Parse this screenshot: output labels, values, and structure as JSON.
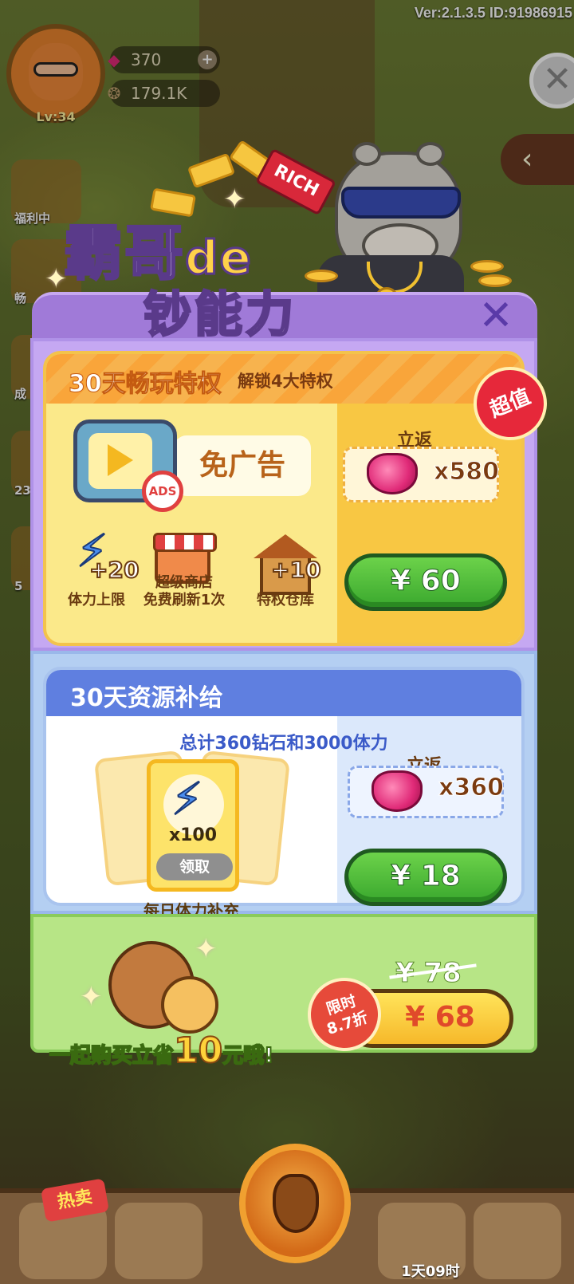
{
  "hud": {
    "version": "Ver:2.1.3.5 ID:91986915",
    "level": "Lv:34",
    "gems": "370",
    "acorns": "179.1K",
    "left_menu_labels": [
      "福利中",
      "畅",
      "成",
      "23",
      "5"
    ]
  },
  "banner": {
    "title_line1": "霸哥",
    "title_de": "de",
    "title_line2": "钞能力",
    "rich_label": "RICH",
    "dollar_symbol": "$"
  },
  "pack1": {
    "title": "30天畅玩特权",
    "subtitle": "解锁4大特权",
    "noad_label": "免广告",
    "noad_badge": "ADS",
    "badge": "超值",
    "perks": [
      {
        "value": "+20",
        "label": "体力上限"
      },
      {
        "value": "超级商店",
        "label": "免费刷新1次"
      },
      {
        "value": "+10",
        "label": "特权仓库"
      }
    ],
    "rebate_label": "立返",
    "rebate_count": "x580",
    "price": "¥ 60"
  },
  "pack2": {
    "title": "30天资源补给",
    "subtitle": "总计360钻石和3000体力",
    "card_count": "x100",
    "claim_label": "领取",
    "daily_label": "每日体力补充",
    "rebate_label": "立返",
    "rebate_count": "x360",
    "price": "¥ 18"
  },
  "bundle": {
    "save_prefix": "一起购买立省",
    "save_number": "10",
    "save_suffix": "元哦!",
    "old_price": "¥ 78",
    "price": "¥ 68",
    "limited_line1": "限时",
    "limited_line2": "8.7折"
  },
  "nav": {
    "hot_label": "热卖",
    "timer": "1天09时"
  },
  "colors": {
    "purple_frame": "#a07ad8",
    "orange_header": "#f9a53a",
    "blue_header": "#5f7fe0",
    "green_button": "#3aa82e",
    "gold_button": "#f6b82a"
  },
  "icons": [
    "gem-icon",
    "acorn-icon",
    "plus-icon",
    "close-icon",
    "back-arrow-icon",
    "tv-icon",
    "no-ads-icon",
    "lightning-icon",
    "shop-icon",
    "house-icon"
  ]
}
